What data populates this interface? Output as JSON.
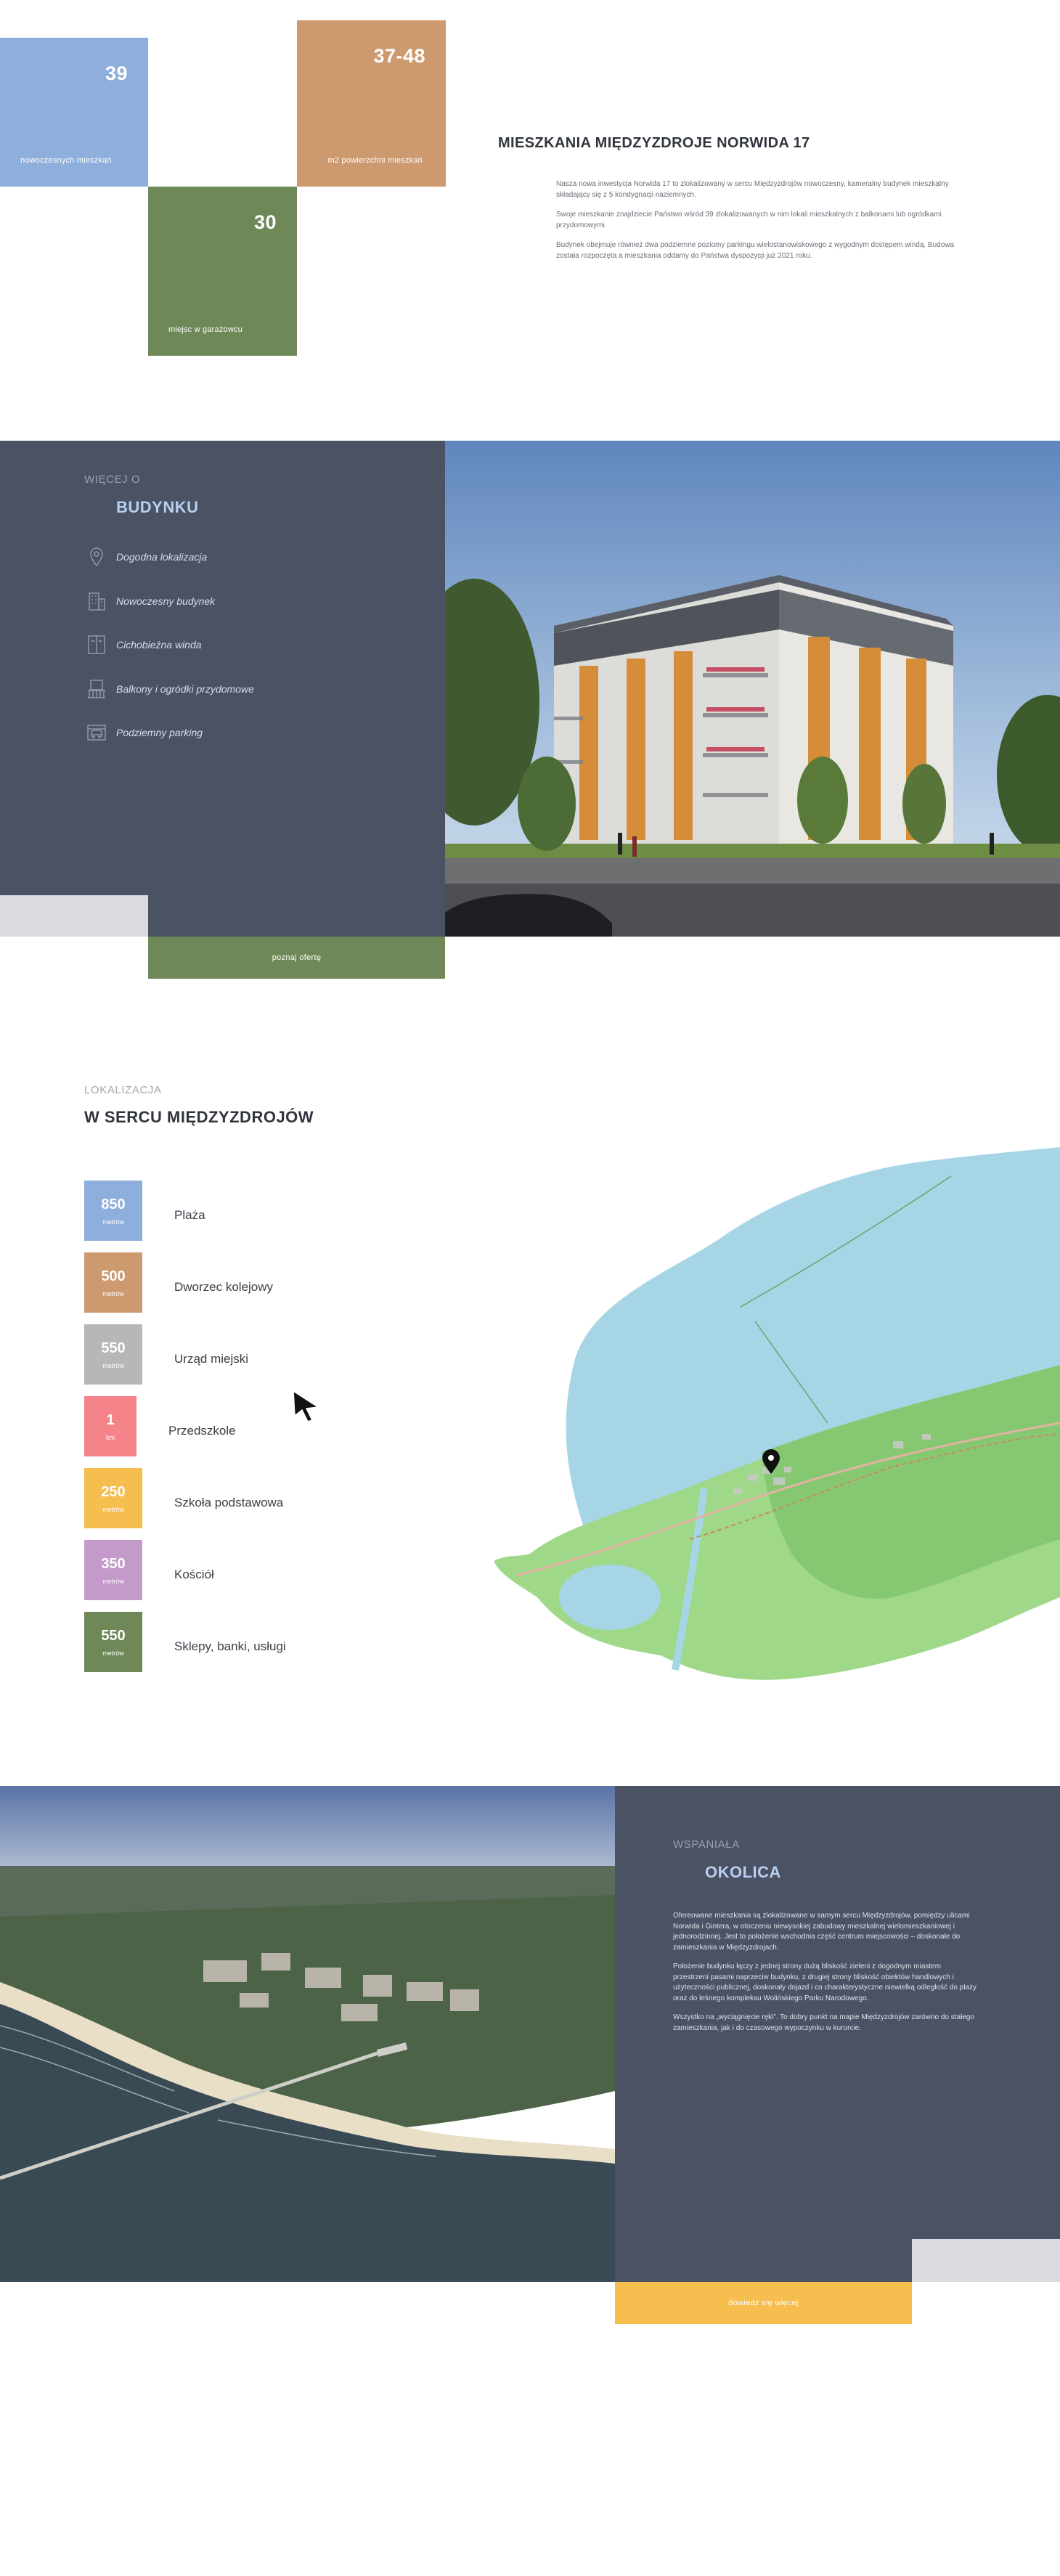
{
  "stats": [
    {
      "value": "39",
      "caption": "nowoczesnych mieszkań"
    },
    {
      "value": "37-48",
      "caption": "m2 powierzchni mieszkań"
    },
    {
      "value": "30",
      "caption": "miejsc w garażowcu"
    }
  ],
  "hero": {
    "title": "MIESZKANIA MIĘDZYZDROJE NORWIDA 17",
    "paragraphs": [
      "Nasza nowa inwestycja Norwida 17 to zlokalizowany w sercu Międzyzdrojów nowoczesny, kameralny budynek mieszkalny składający się z 5 kondygnacji naziemnych.",
      "Swoje mieszkanie znajdziecie Państwo wśród 39 zlokalizowanych w nim lokali mieszkalnych z balkonami lub ogródkami przydomowymi.",
      "Budynek obejmuje również dwa podziemne poziomy parkingu wielostanowiskowego z wygodnym dostępem windą. Budowa została rozpoczęta a mieszkania oddamy do Państwa dyspozycji już 2021 roku."
    ]
  },
  "building": {
    "eyebrow": "WIĘCEJ O",
    "title": "BUDYNKU",
    "features": [
      {
        "icon": "map-pin-icon",
        "label": "Dogodna lokalizacja"
      },
      {
        "icon": "building-icon",
        "label": "Nowoczesny budynek"
      },
      {
        "icon": "elevator-icon",
        "label": "Cichobieżna winda"
      },
      {
        "icon": "balcony-icon",
        "label": "Balkony i ogródki przydomowe"
      },
      {
        "icon": "parking-icon",
        "label": "Podziemny parking"
      }
    ],
    "cta": "poznaj ofertę"
  },
  "location": {
    "eyebrow": "LOKALIZACJA",
    "title": "W SERCU MIĘDZYZDROJÓW",
    "distances": [
      {
        "value": "850",
        "unit": "metrów",
        "place": "Plaża",
        "color": "#8eaedb"
      },
      {
        "value": "500",
        "unit": "metrów",
        "place": "Dworzec kolejowy",
        "color": "#cd9a70"
      },
      {
        "value": "550",
        "unit": "metrów",
        "place": "Urząd miejski",
        "color": "#b7b7b7"
      },
      {
        "value": "1",
        "unit": "km",
        "place": "Przedszkole",
        "color": "#f4848a"
      },
      {
        "value": "250",
        "unit": "metrów",
        "place": "Szkoła podstawowa",
        "color": "#f6bd4f"
      },
      {
        "value": "350",
        "unit": "metrów",
        "place": "Kościół",
        "color": "#c39ac9"
      },
      {
        "value": "550",
        "unit": "metrów",
        "place": "Sklepy, banki, usługi",
        "color": "#6e8957"
      }
    ]
  },
  "surroundings": {
    "eyebrow": "WSPANIAŁA",
    "title": "OKOLICA",
    "paragraphs": [
      "Ofereowane mieszkania są zlokalizowane w samym sercu Międzyzdrojów, pomiędzy ulicami Norwida i Gintera, w otoczeniu niewysokiej zabudowy mieszkalnej wielomieszkaniowej i jednorodzinnej. Jest to położenie wschodnia część centrum miejscowości – doskonałe do zamieszkania w Międzyzdrojach.",
      "Położenie budynku łączy z jednej strony dużą bliskość zieleni z dogodnym miastem przestrzeni pasami naprzeciw budynku, z drugiej strony bliskość obiektów handlowych i użyteczności publicznej, doskonały dojazd i co charakterystyczne niewielką odległość do plaży oraz do leśnego kompleksu Wolińskiego Parku Narodowego.",
      "Wszystko na „wyciągnięcie ręki”. To dobry punkt na mapie Międzyzdrojów zarówno do stałego zamieszkania, jak i do czasowego wypoczynku w kurorcie."
    ],
    "cta": "dowiedz się więcej"
  }
}
